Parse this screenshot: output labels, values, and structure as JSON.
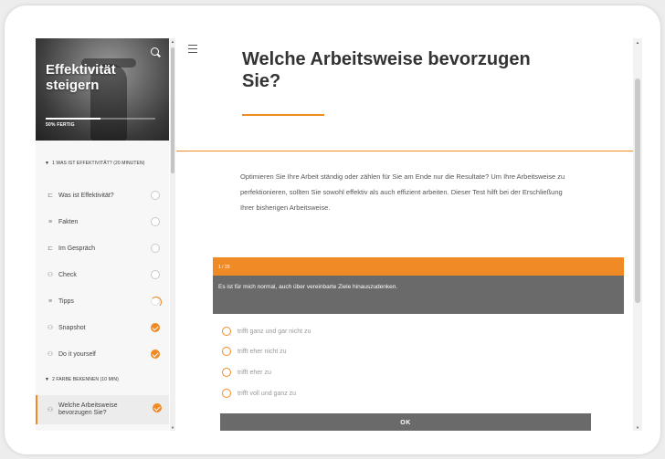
{
  "sidebar": {
    "hero_title": "Effektivität steigern",
    "progress_label": "50% FERTIG",
    "progress_fraction": 0.5,
    "section1": "1 WAS IST EFFEKTIVITÄT? (20 MINUTEN)",
    "section2": "2 FARBE BEKENNEN (10 MIN)",
    "items": [
      {
        "label": "Was ist Effektivität?",
        "icon": "video-icon",
        "glyph": "⊏",
        "status": "empty"
      },
      {
        "label": "Fakten",
        "icon": "list-icon",
        "glyph": "≡",
        "status": "empty"
      },
      {
        "label": "Im Gespräch",
        "icon": "video-icon",
        "glyph": "⊏",
        "status": "empty"
      },
      {
        "label": "Check",
        "icon": "people-icon",
        "glyph": "⚇",
        "status": "empty"
      },
      {
        "label": "Tipps",
        "icon": "list-icon",
        "glyph": "≡",
        "status": "partial"
      },
      {
        "label": "Snapshot",
        "icon": "people-icon",
        "glyph": "⚇",
        "status": "done"
      },
      {
        "label": "Do it yourself",
        "icon": "people-icon",
        "glyph": "⚇",
        "status": "done"
      },
      {
        "label": "Welche Arbeitsweise bevorzugen Sie?",
        "icon": "people-icon",
        "glyph": "⚇",
        "status": "done"
      }
    ]
  },
  "main": {
    "title": "Welche Arbeitsweise bevorzugen Sie?",
    "intro": "Optimieren Sie Ihre Arbeit ständig oder zählen für Sie am Ende nur die Resultate? Um Ihre Arbeitsweise zu perfektionieren, sollten Sie sowohl effektiv als auch effizient arbeiten. Dieser Test hilft bei der Erschließung Ihrer bisherigen Arbeitsweise.",
    "question_counter": "1 / 20",
    "question_text": "Es ist für mich normal, auch über vereinbarte Ziele hinauszudenken.",
    "options": [
      "trifft ganz und gar nicht zu",
      "trifft eher nicht zu",
      "trifft eher zu",
      "trifft voll und ganz zu"
    ],
    "ok_label": "OK"
  },
  "colors": {
    "accent": "#f08a24",
    "question_bg": "#6a6a6a"
  }
}
